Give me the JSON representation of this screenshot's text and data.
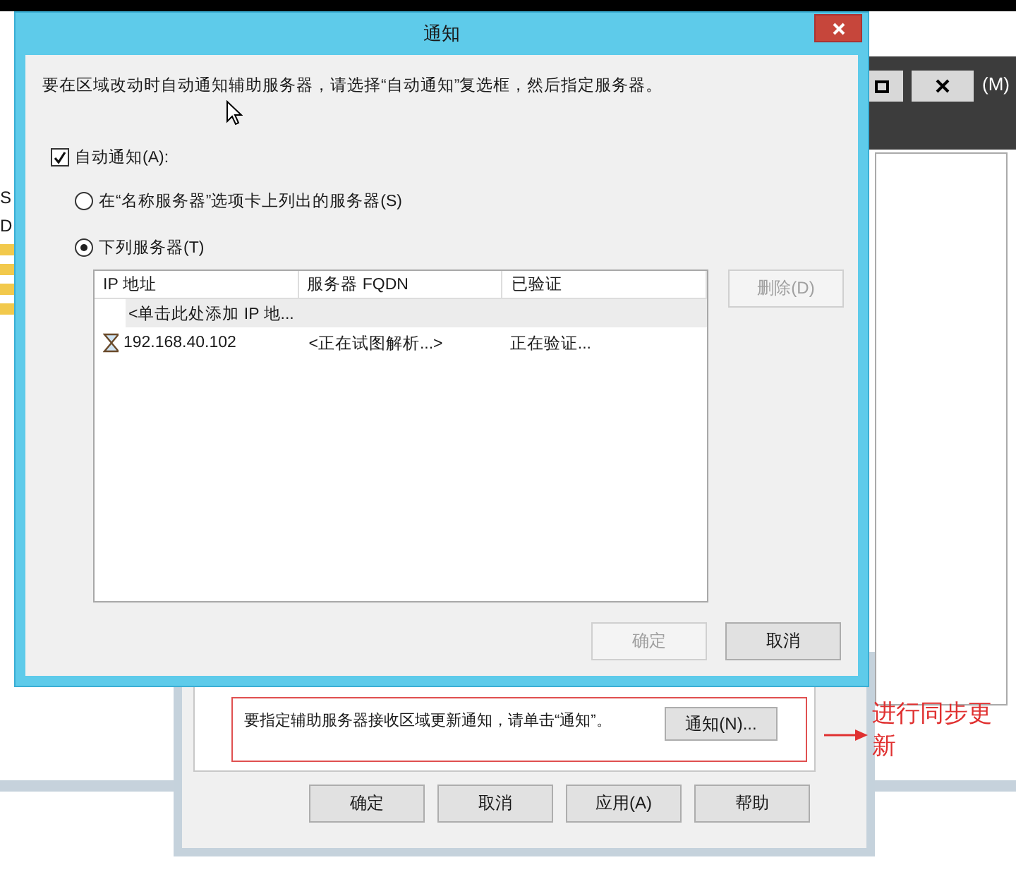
{
  "background_window": {
    "menu_text": "(M)",
    "list_items": [
      "S",
      "D"
    ]
  },
  "properties_dialog": {
    "notify_hint": "要指定辅助服务器接收区域更新通知，请单击“通知”。",
    "notify_button": "通知(N)...",
    "buttons": [
      "确定",
      "取消",
      "应用(A)",
      "帮助"
    ]
  },
  "annotation": {
    "text": "进行同步更新"
  },
  "notify_dialog": {
    "title": "通知",
    "description": "要在区域改动时自动通知辅助服务器，请选择“自动通知”复选框，然后指定服务器。",
    "auto_notify": {
      "label": "自动通知(A):",
      "checked": true
    },
    "options": [
      {
        "label": "在“名称服务器”选项卡上列出的服务器(S)",
        "selected": false
      },
      {
        "label": "下列服务器(T)",
        "selected": true
      }
    ],
    "table": {
      "columns": [
        "IP 地址",
        "服务器 FQDN",
        "已验证"
      ],
      "rows": [
        {
          "kind": "add",
          "cells": [
            "<单击此处添加 IP 地..."
          ]
        },
        {
          "kind": "pending",
          "cells": [
            "192.168.40.102",
            "<正在试图解析...>",
            "正在验证..."
          ]
        }
      ]
    },
    "delete_button": {
      "label": "删除(D)",
      "disabled": true
    },
    "buttons": [
      {
        "label": "确定",
        "disabled": true
      },
      {
        "label": "取消",
        "disabled": false
      }
    ]
  }
}
